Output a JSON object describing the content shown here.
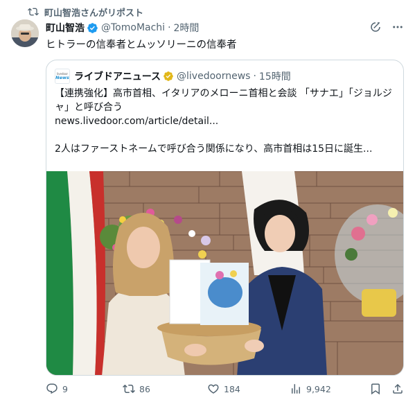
{
  "repost": {
    "text": "町山智浩さんがリポスト",
    "icon": "repost-icon"
  },
  "post": {
    "author_name": "町山智浩",
    "handle": "@TomoMachi",
    "time": "2時間",
    "text": "ヒトラーの信奉者とムッソリーニの信奉者",
    "verified_color": "#1d9bf0"
  },
  "quote": {
    "logo_top": "livedoor",
    "logo_bottom": "News",
    "author_name": "ライブドアニュース",
    "handle": "@livedoornews",
    "time": "15時間",
    "verified_color": "#e2b719",
    "line1": "【連携強化】高市首相、イタリアのメローニ首相と会談 「サナエ」「ジョルジャ」と呼び合う",
    "link": "news.livedoor.com/article/detail...",
    "line2": "2人はファーストネームで呼び合う関係になり、高市首相は15日に誕生..."
  },
  "actions": {
    "replies": "9",
    "reposts": "86",
    "likes": "184",
    "views": "9,942"
  }
}
